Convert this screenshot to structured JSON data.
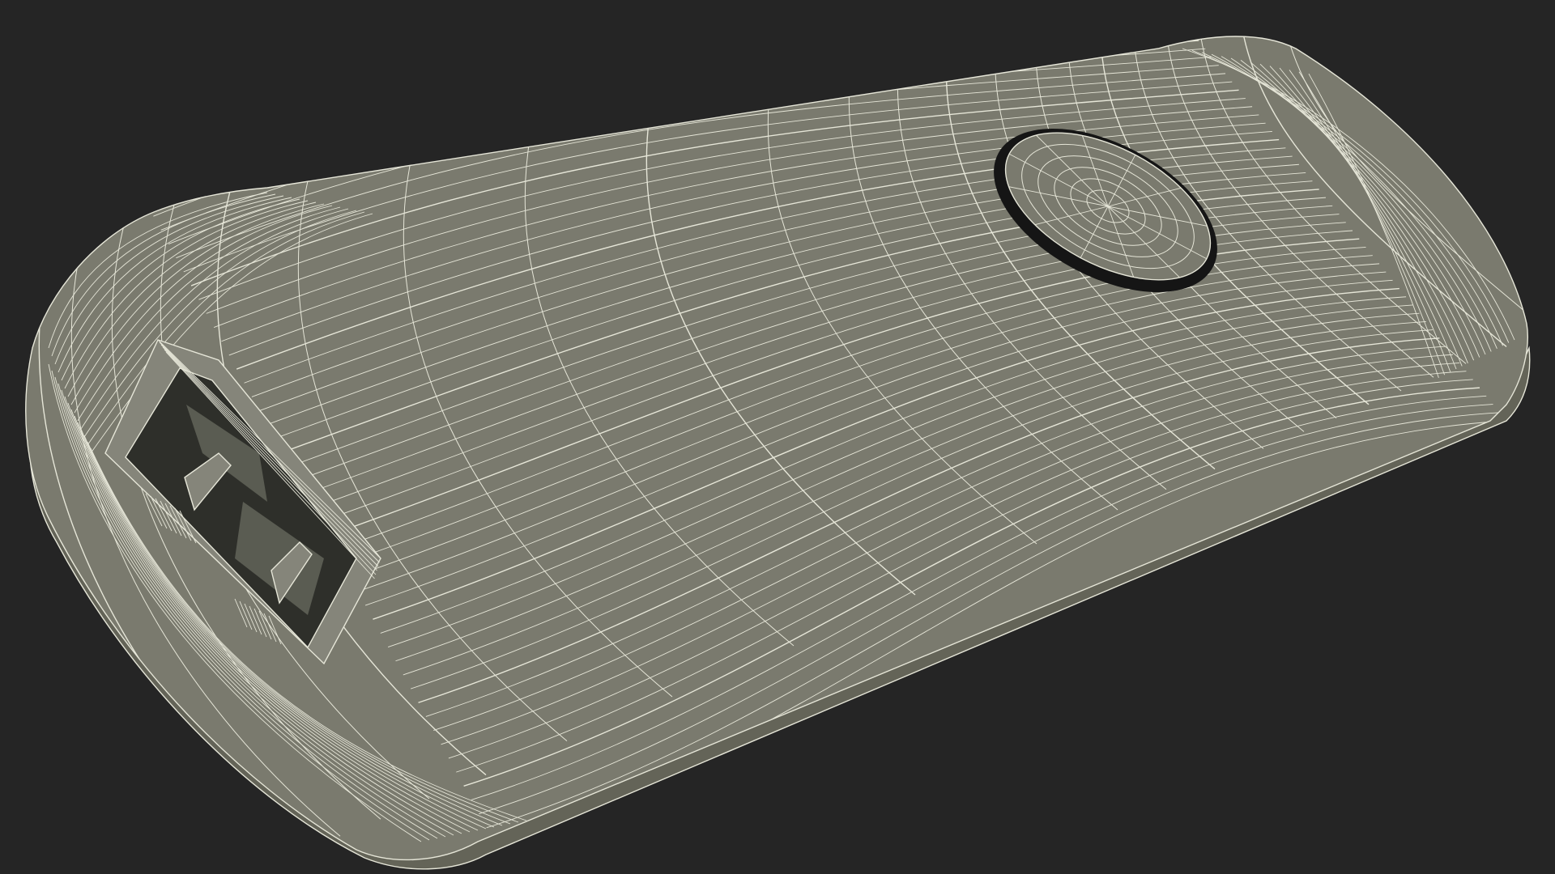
{
  "scene": {
    "description_visible_text": "",
    "background_color": "#252525",
    "model_color": "#7a7a6e",
    "model_shadow_color": "#646458",
    "model_highlight_color": "#85857a",
    "wire_color": "#e6e6d8",
    "socket_dark_color": "#2e2f2a",
    "socket_inner_color": "#5a5c52",
    "button_slot_color": "#151515",
    "icons": [
      "wireframe-model",
      "power-socket",
      "oval-button"
    ]
  }
}
